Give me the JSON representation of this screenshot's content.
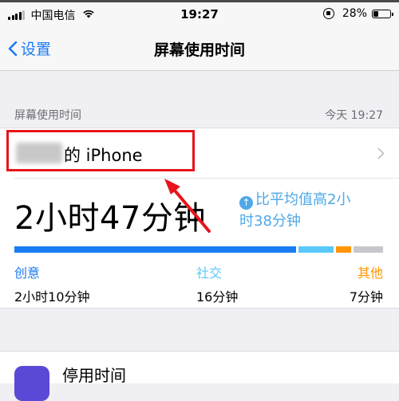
{
  "status_bar": {
    "carrier": "中国电信",
    "time": "19:27",
    "battery": "28%",
    "battery_level": 0.28
  },
  "nav": {
    "back_label": "设置",
    "title": "屏幕使用时间"
  },
  "section": {
    "header": "屏幕使用时间",
    "date": "今天 19:27"
  },
  "device": {
    "name": "的 iPhone"
  },
  "summary": {
    "total": "2小时47分钟",
    "comparison_line1": "比平均值高2小",
    "comparison_line2": "时38分钟"
  },
  "categories": [
    {
      "label": "创意",
      "value": "2小时10分钟",
      "color": "#1a7cf5",
      "minutes": 130
    },
    {
      "label": "社交",
      "value": "16分钟",
      "color": "#5ac8fa",
      "minutes": 16
    },
    {
      "label": "其他",
      "value": "7分钟",
      "color": "#ff9500",
      "minutes": 7
    }
  ],
  "downtime": {
    "label": "停用时间"
  }
}
